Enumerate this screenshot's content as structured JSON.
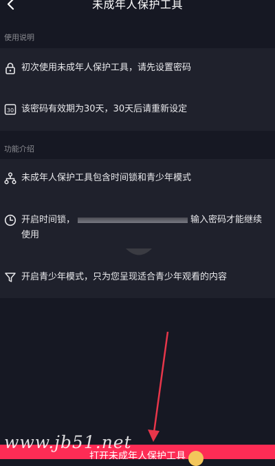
{
  "header": {
    "title": "未成年人保护工具",
    "back_icon": "chevron-left-icon"
  },
  "usage": {
    "label": "使用说明",
    "items": [
      {
        "icon": "lock-icon",
        "text": "初次使用未成年人保护工具，请先设置密码"
      },
      {
        "icon": "calendar-30-icon",
        "text": "该密码有效期为30天，30天后请重新设定"
      }
    ]
  },
  "features": {
    "label": "功能介绍",
    "items": [
      {
        "icon": "hierarchy-icon",
        "text": "未成年人保护工具包含时间锁和青少年模式"
      },
      {
        "icon": "clock-icon",
        "text_before": "开启时间锁，",
        "text_after": "输入密码才能继续",
        "text_line2": "使用"
      },
      {
        "icon": "filter-icon",
        "text": "开启青少年模式，只为您呈现适合青少年观看的内容"
      }
    ]
  },
  "cta": {
    "label": "打开未成年人保护工具"
  },
  "watermark": "www.jb51.net",
  "colors": {
    "background": "#161823",
    "card": "#1f212c",
    "accent": "#fe2c55",
    "annotation_arrow": "#e8364a"
  }
}
